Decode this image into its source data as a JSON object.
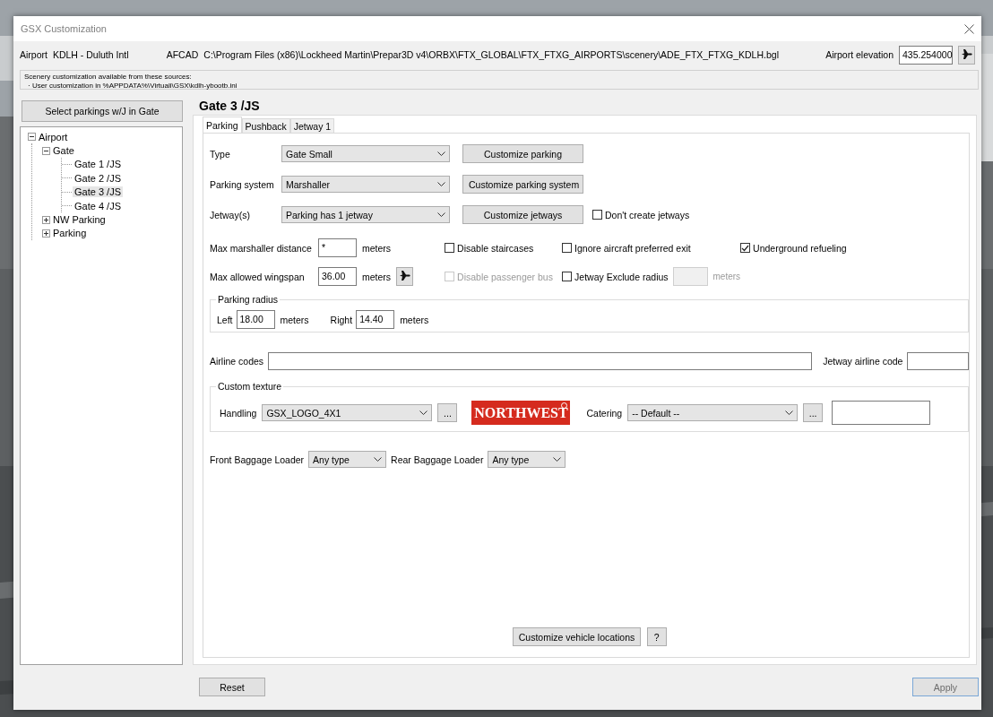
{
  "window": {
    "title": "GSX Customization"
  },
  "airport": {
    "label": "Airport",
    "value": "KDLH - Duluth Intl"
  },
  "afcad": {
    "label": "AFCAD",
    "value": "C:\\Program Files (x86)\\Lockheed Martin\\Prepar3D v4\\ORBX\\FTX_GLOBAL\\FTX_FTXG_AIRPORTS\\scenery\\ADE_FTX_FTXG_KDLH.bgl"
  },
  "elevation": {
    "label": "Airport elevation",
    "value": "435.254000"
  },
  "sources": [
    "Scenery customization available from these sources:",
    "· User customization in %APPDATA%\\Virtuali\\GSX\\kdlh-ybootb.ini"
  ],
  "select_button": "Select parkings w/J in Gate",
  "tree": [
    {
      "label": "Airport",
      "expanded": true,
      "selected": false,
      "children": [
        {
          "label": "Gate",
          "expanded": true,
          "selected": false,
          "children": [
            {
              "label": "Gate 1 /JS",
              "selected": false
            },
            {
              "label": "Gate 2 /JS",
              "selected": false
            },
            {
              "label": "Gate 3 /JS",
              "selected": true
            },
            {
              "label": "Gate 4 /JS",
              "selected": false
            }
          ]
        },
        {
          "label": "NW Parking",
          "expanded": false,
          "selected": false
        },
        {
          "label": "Parking",
          "expanded": false,
          "selected": false
        }
      ]
    }
  ],
  "panel_title": "Gate 3 /JS",
  "tabs": [
    {
      "label": "Parking",
      "selected": true
    },
    {
      "label": "Pushback",
      "selected": false
    },
    {
      "label": "Jetway 1",
      "selected": false
    }
  ],
  "select_rows": [
    {
      "label": "Type",
      "value": "Gate Small",
      "button": "Customize parking"
    },
    {
      "label": "Parking system",
      "value": "Marshaller",
      "button": "Customize parking system"
    },
    {
      "label": "Jetway(s)",
      "value": "Parking has 1 jetway",
      "button": "Customize jetways",
      "check": {
        "label": "Don't create jetways",
        "checked": false
      }
    }
  ],
  "distance_rows": [
    {
      "kind": "plain",
      "label": "Max marshaller distance",
      "value": "*",
      "unit": "meters",
      "checks": [
        {
          "label": "Disable staircases",
          "checked": false,
          "disabled": false
        },
        {
          "label": "Ignore aircraft preferred exit",
          "checked": false,
          "disabled": false
        },
        {
          "label": "Underground refueling",
          "checked": true,
          "disabled": false
        }
      ]
    },
    {
      "kind": "with-button",
      "label": "Max allowed wingspan",
      "value": "36.00",
      "unit": "meters",
      "checks": [
        {
          "label": "Disable passenger bus",
          "checked": false,
          "disabled": true
        },
        {
          "label": "Jetway Exclude radius",
          "checked": false,
          "disabled": false,
          "radius": {
            "unit": "meters",
            "disabled": true
          }
        }
      ]
    }
  ],
  "parking_radius": {
    "title": "Parking radius",
    "sides": [
      {
        "label": "Left",
        "value": "18.00",
        "unit": "meters"
      },
      {
        "label": "Right",
        "value": "14.40",
        "unit": "meters"
      }
    ]
  },
  "airline_codes": {
    "label": "Airline codes"
  },
  "jetway_airline_code": {
    "label": "Jetway airline code"
  },
  "custom_texture": {
    "title": "Custom texture",
    "handling": {
      "label": "Handling",
      "value": "GSX_LOGO_4X1",
      "browse": "..."
    },
    "preview": "NORTHWEST",
    "catering": {
      "label": "Catering",
      "value": "-- Default --",
      "browse": "..."
    }
  },
  "baggage": [
    {
      "label": "Front Baggage Loader",
      "value": "Any type"
    },
    {
      "label": "Rear Baggage Loader",
      "value": "Any type"
    }
  ],
  "vehicle_button": "Customize vehicle locations",
  "help_button": "?",
  "reset_button": "Reset",
  "apply": {
    "label": "Apply",
    "disabled": true
  }
}
